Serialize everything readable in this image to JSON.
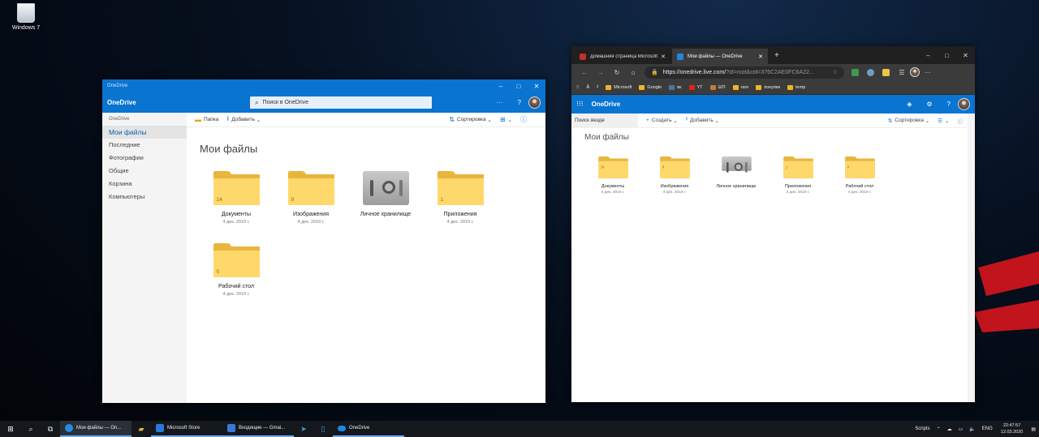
{
  "desktop": {
    "recycle_bin_label": "Windows 7"
  },
  "onedrive_app": {
    "window_title": "OneDrive",
    "brand": "OneDrive",
    "search_placeholder": "Поиск в OneDrive",
    "more_label": "···",
    "help_label": "?",
    "breadcrumb": "OneDrive",
    "nav": [
      "Мои файлы",
      "Последние",
      "Фотографии",
      "Общие",
      "Корзина",
      "Компьютеры"
    ],
    "commands": {
      "new_folder": "Папка",
      "add": "Добавить",
      "sort": "Сортировка",
      "view": "⊞",
      "info": "ⓘ"
    },
    "heading": "Мои файлы",
    "items": [
      {
        "name": "Документы",
        "date": "4 дек. 2019 г.",
        "count": "14",
        "type": "folder"
      },
      {
        "name": "Изображения",
        "date": "4 дек. 2019 г.",
        "count": "9",
        "type": "folder"
      },
      {
        "name": "Личное хранилище",
        "date": "",
        "count": "",
        "type": "vault"
      },
      {
        "name": "Приложения",
        "date": "4 дек. 2019 г.",
        "count": "1",
        "type": "folder"
      },
      {
        "name": "Рабочий стол",
        "date": "4 дек. 2019 г.",
        "count": "0",
        "type": "folder"
      }
    ]
  },
  "browser": {
    "tabs": [
      {
        "title": "Домашняя страница Microsoft",
        "color": "#c4302b"
      },
      {
        "title": "Мои файлы — OneDrive",
        "color": "#1e88e5"
      }
    ],
    "new_tab": "+",
    "url_host": "https://onedrive.live.com/",
    "url_rest": "?id=root&cid=376C2AE0FC6A22...",
    "bookmarks": [
      {
        "label": "Microsoft",
        "color": "#f0b429"
      },
      {
        "label": "Google",
        "color": "#f0b429"
      },
      {
        "label": "вк",
        "color": "#4a76a8"
      },
      {
        "label": "YT",
        "color": "#e62117"
      },
      {
        "label": "ШП",
        "color": "#c47a3c"
      },
      {
        "label": "rare",
        "color": "#f0b429"
      },
      {
        "label": "покупки",
        "color": "#f0b429"
      },
      {
        "label": "temp",
        "color": "#f0b429"
      }
    ],
    "page": {
      "brand": "OneDrive",
      "search_placeholder": "Поиск везде",
      "commands": {
        "create": "Создать",
        "add": "Добавить",
        "sort": "Сортировка"
      },
      "heading": "Мои файлы",
      "items": [
        {
          "name": "Документы",
          "date": "4 дек. 2019 г.",
          "count": "14",
          "type": "folder"
        },
        {
          "name": "Изображения",
          "date": "4 дек. 2019 г.",
          "count": "9",
          "type": "folder"
        },
        {
          "name": "Личное хранилище",
          "date": "",
          "count": "",
          "type": "vault"
        },
        {
          "name": "Приложения",
          "date": "4 дек. 2019 г.",
          "count": "1",
          "type": "folder"
        },
        {
          "name": "Рабочий стол",
          "date": "4 дек. 2019 г.",
          "count": "0",
          "type": "folder"
        }
      ]
    }
  },
  "taskbar": {
    "apps": [
      {
        "label": "Мои файлы — On...",
        "color": "#2a8be0"
      },
      {
        "label": "Microsoft Store",
        "color": "#2c7ad6"
      },
      {
        "label": "Входящие — Gmai...",
        "color": "#3a78d8"
      },
      {
        "label": "OneDrive",
        "color": "#1e88e5"
      }
    ],
    "tray": {
      "scripts": "Scripts",
      "lang": "ENG",
      "time": "22:47:57",
      "date": "12.03.2020"
    }
  }
}
